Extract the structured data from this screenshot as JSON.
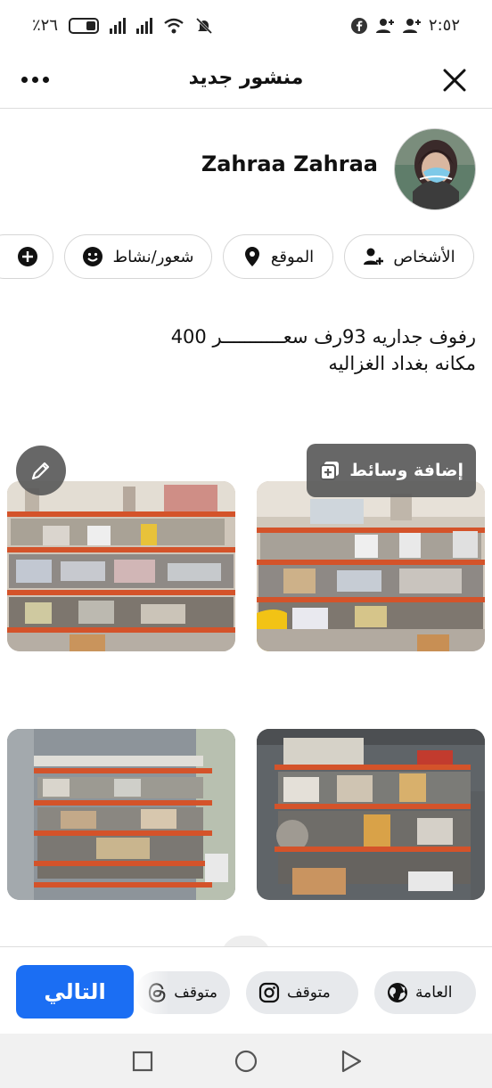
{
  "status_bar": {
    "time": "٢:٥٢",
    "battery": "٪٢٦"
  },
  "header": {
    "title": "منشور جديد"
  },
  "user": {
    "name": "Zahraa Zahraa"
  },
  "chips": {
    "people": "الأشخاص",
    "location": "الموقع",
    "feeling": "شعور/نشاط"
  },
  "post": {
    "line1": "رفوف جداريه 93رف سعـــــــــــر 400",
    "line2": "مكانه بغداد الغزاليه"
  },
  "media": {
    "add_media_label": "إضافة وسائط"
  },
  "bottom": {
    "audience_label": "العامة",
    "instagram_label": "متوقف",
    "threads_label": "متوقف",
    "next_label": "التالي"
  },
  "colors": {
    "primary": "#1b6ef3",
    "shelf_orange": "#d4532a"
  }
}
